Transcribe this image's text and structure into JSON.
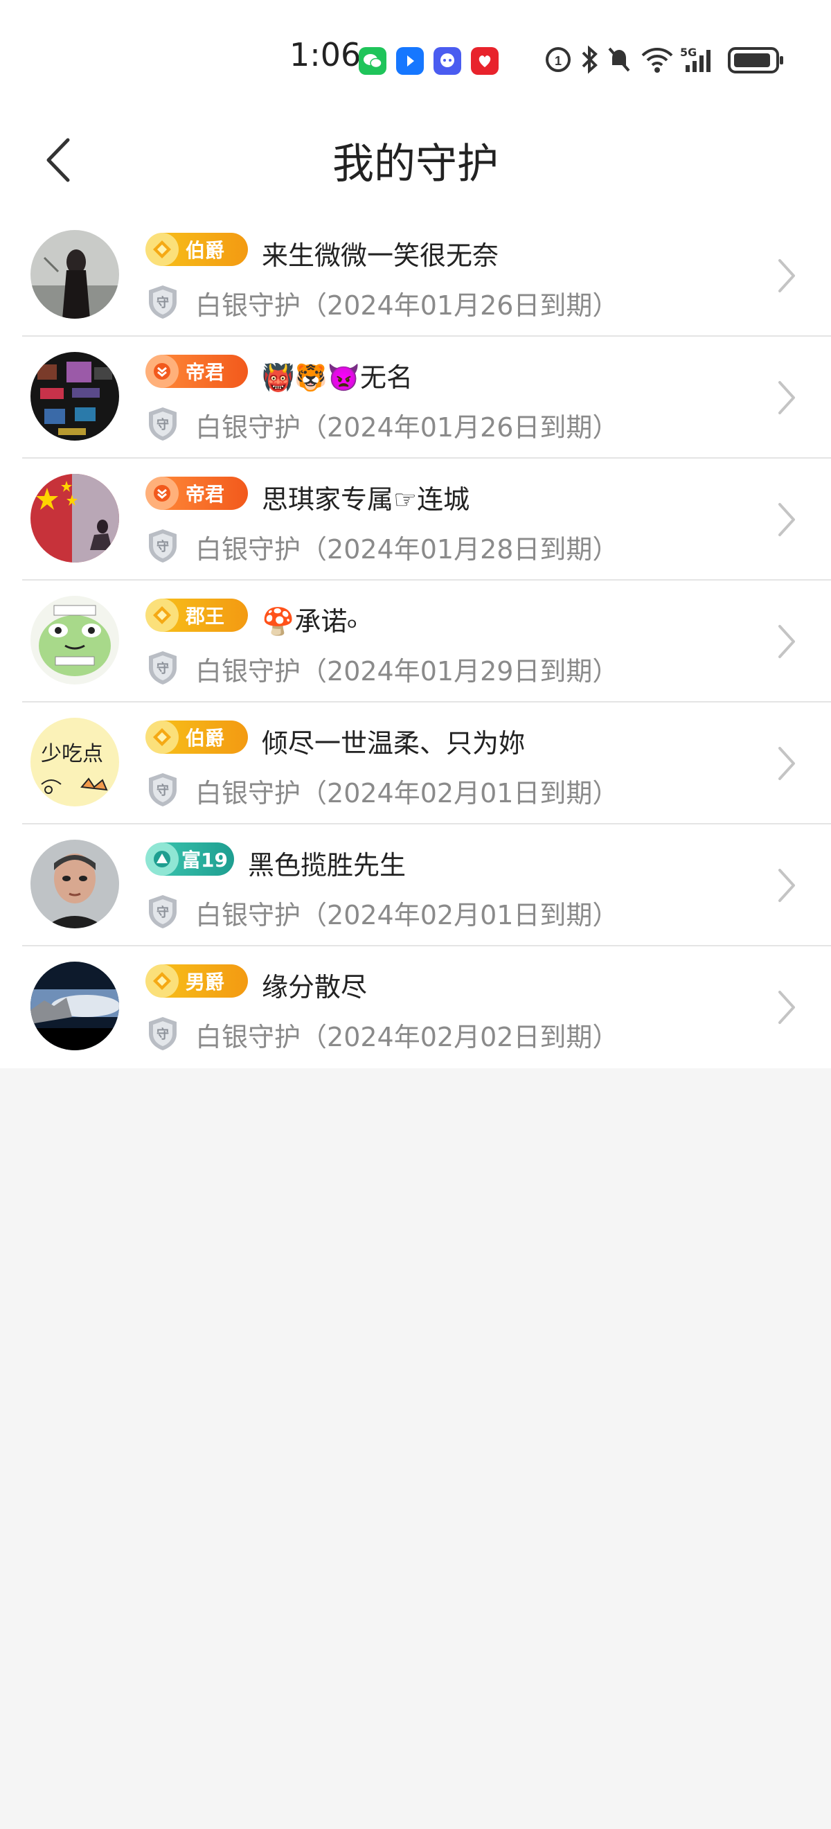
{
  "status_bar": {
    "time": "1:06",
    "network": "5G"
  },
  "header": {
    "title": "我的守护"
  },
  "guards": [
    {
      "badge_label": "伯爵",
      "badge_style": "gold",
      "name": "来生微微一笑很无奈",
      "guard_level": "白银守护",
      "expiry": "（2024年01月26日到期）"
    },
    {
      "badge_label": "帝君",
      "badge_style": "red",
      "name": "👹🐯👿无名",
      "guard_level": "白银守护",
      "expiry": "（2024年01月26日到期）"
    },
    {
      "badge_label": "帝君",
      "badge_style": "red",
      "name": "思琪家专属☞连城",
      "guard_level": "白银守护",
      "expiry": "（2024年01月28日到期）"
    },
    {
      "badge_label": "郡王",
      "badge_style": "gold",
      "name": "🍄承诺৹",
      "guard_level": "白银守护",
      "expiry": "（2024年01月29日到期）"
    },
    {
      "badge_label": "伯爵",
      "badge_style": "gold",
      "name": "倾尽一世温柔、只为妳",
      "guard_level": "白银守护",
      "expiry": "（2024年02月01日到期）"
    },
    {
      "badge_label": "富19",
      "badge_style": "teal",
      "name": "黑色揽胜先生",
      "guard_level": "白银守护",
      "expiry": "（2024年02月01日到期）"
    },
    {
      "badge_label": "男爵",
      "badge_style": "gold",
      "name": "缘分散尽",
      "guard_level": "白银守护",
      "expiry": "（2024年02月02日到期）"
    }
  ],
  "avatar_texts": {
    "row5": "少吃点"
  }
}
